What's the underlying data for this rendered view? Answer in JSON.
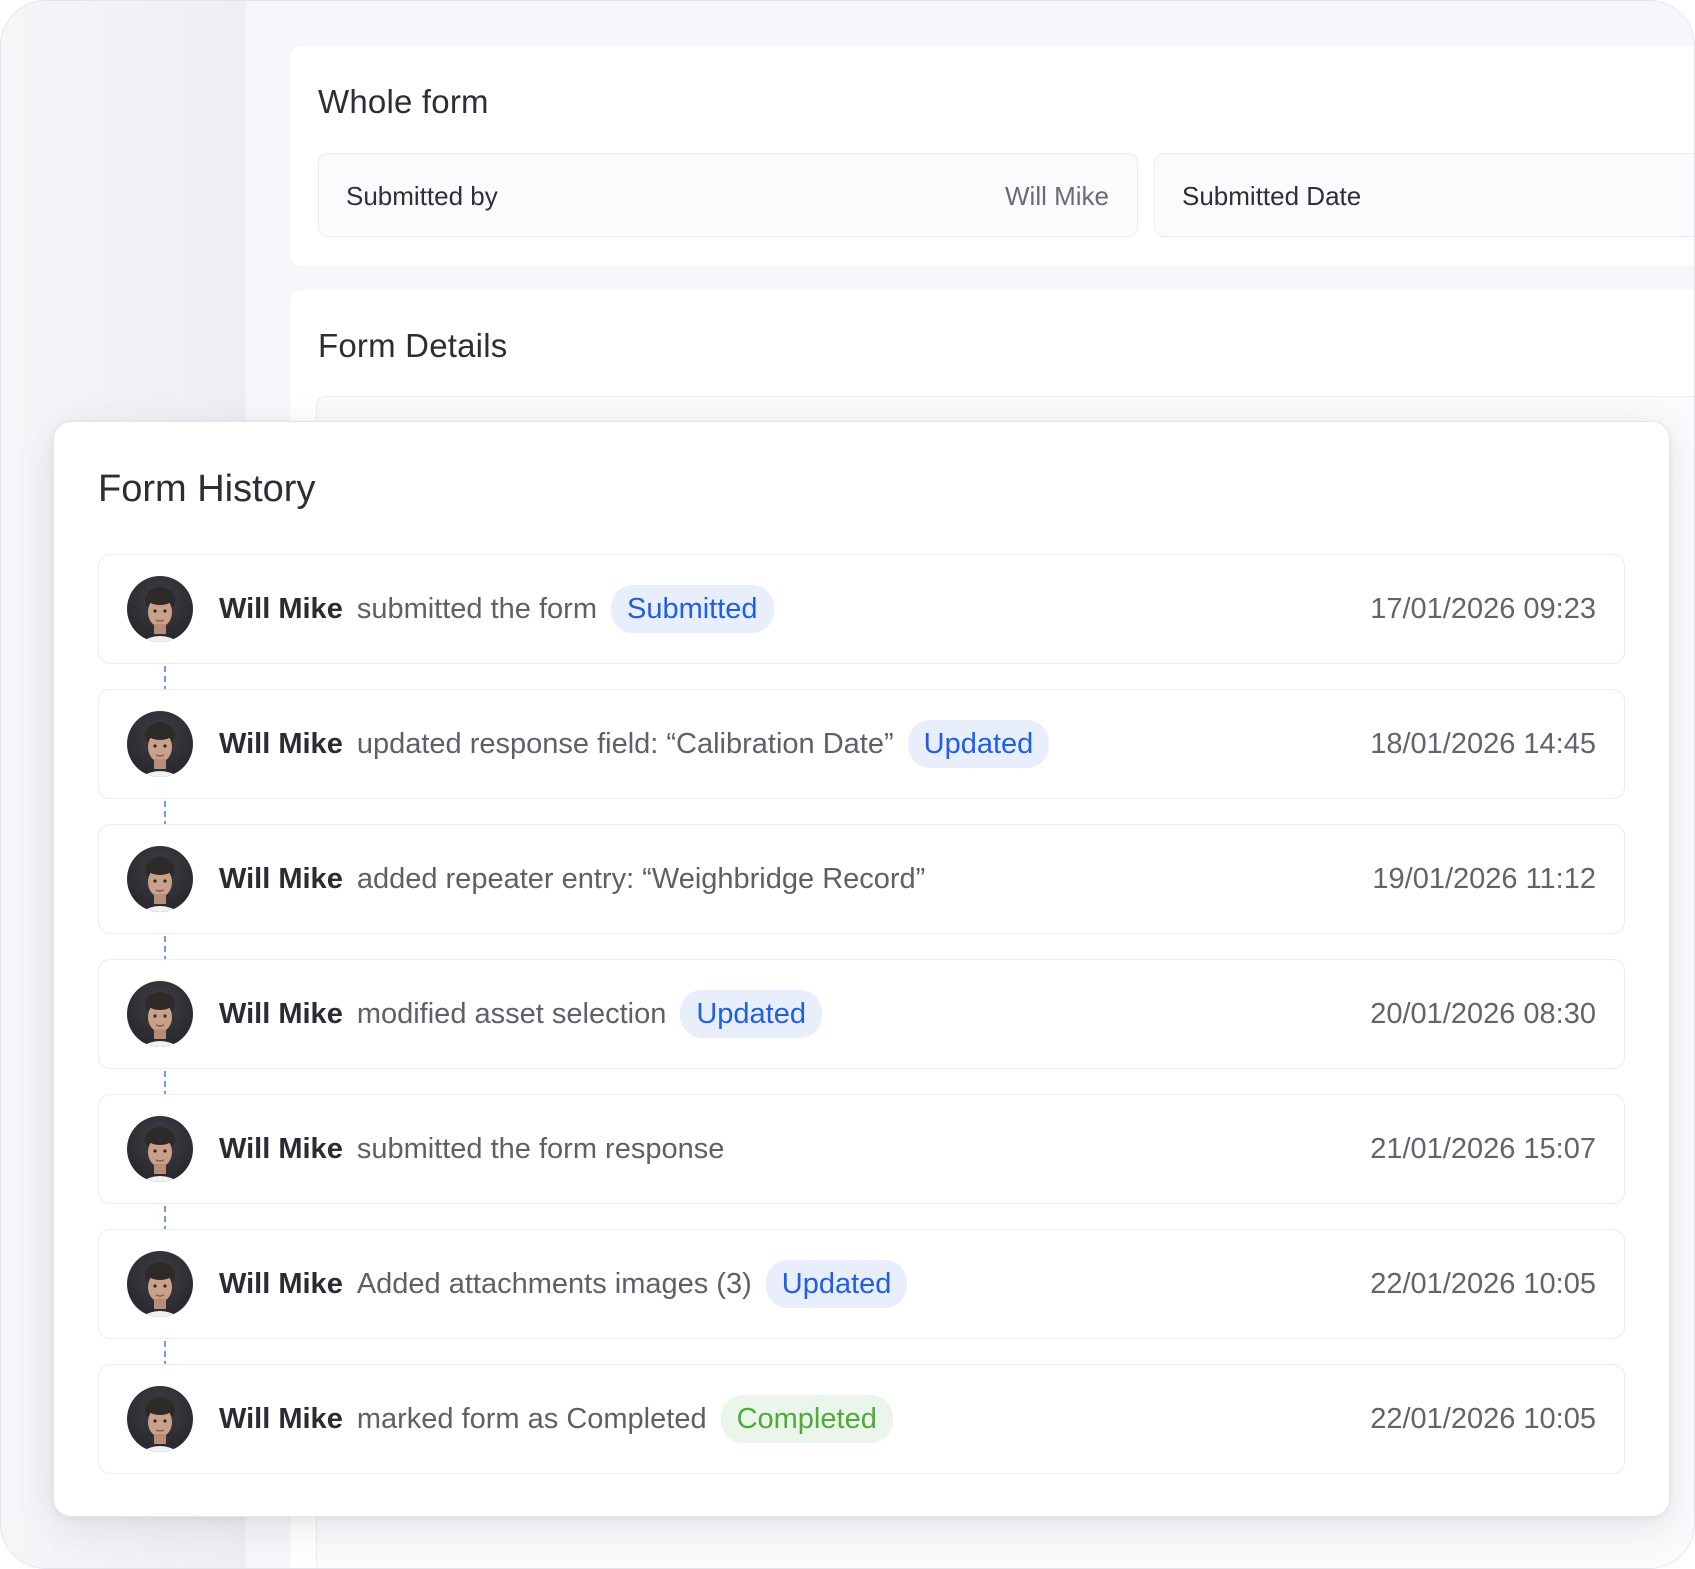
{
  "whole_form": {
    "title": "Whole form",
    "submitted_by_label": "Submitted by",
    "submitted_by_value": "Will Mike",
    "submitted_date_label": "Submitted Date"
  },
  "form_details": {
    "title": "Form Details"
  },
  "history": {
    "title": "Form History",
    "items": [
      {
        "user": "Will Mike",
        "action": "submitted the form",
        "badge": "Submitted",
        "badge_type": "blue",
        "datetime": "17/01/2026  09:23"
      },
      {
        "user": "Will Mike",
        "action": "updated response field: “Calibration Date”",
        "badge": "Updated",
        "badge_type": "blue",
        "datetime": "18/01/2026  14:45"
      },
      {
        "user": "Will Mike",
        "action": "added repeater entry: “Weighbridge Record”",
        "badge": "",
        "badge_type": "",
        "datetime": "19/01/2026  11:12"
      },
      {
        "user": "Will Mike",
        "action": "modified asset selection",
        "badge": "Updated",
        "badge_type": "blue",
        "datetime": "20/01/2026  08:30"
      },
      {
        "user": "Will Mike",
        "action": "submitted the form response",
        "badge": "",
        "badge_type": "",
        "datetime": "21/01/2026  15:07"
      },
      {
        "user": "Will Mike",
        "action": "Added attachments images (3)",
        "badge": "Updated",
        "badge_type": "blue",
        "datetime": "22/01/2026  10:05"
      },
      {
        "user": "Will Mike",
        "action": "marked form as Completed",
        "badge": "Completed",
        "badge_type": "green",
        "datetime": "22/01/2026  10:05"
      }
    ]
  },
  "colors": {
    "badge_blue_text": "#1f5fe6",
    "badge_blue_bg": "#e8eefc",
    "badge_green_text": "#4faa3a",
    "badge_green_bg": "#eaf6ea",
    "connector": "#6f9be3"
  },
  "icons": {
    "avatar": "user-avatar-photo"
  }
}
